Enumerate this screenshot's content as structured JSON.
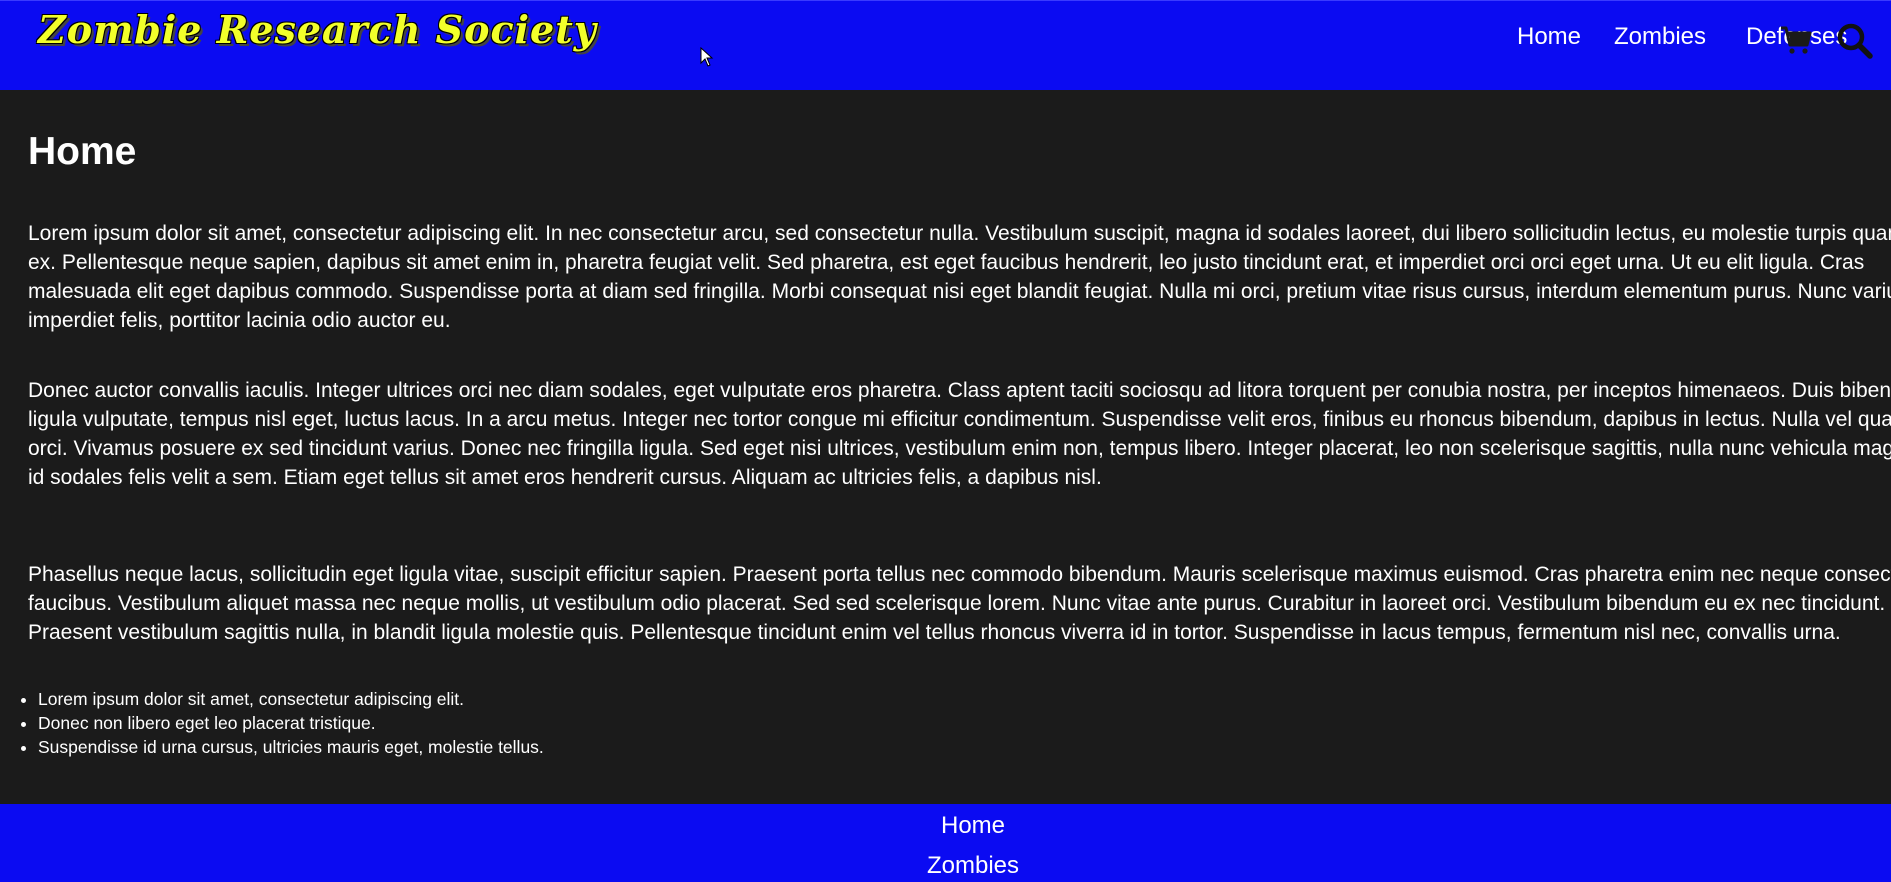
{
  "header": {
    "logo_text": "Zombie Research Society",
    "nav": [
      {
        "label": "Home"
      },
      {
        "label": "Zombies"
      },
      {
        "label": "Defenses"
      }
    ],
    "icons": {
      "cart": "cart-icon",
      "search": "search-icon"
    }
  },
  "main": {
    "title": "Home",
    "paragraphs": [
      "Lorem ipsum dolor sit amet, consectetur adipiscing elit. In nec consectetur arcu, sed consectetur nulla. Vestibulum suscipit, magna id sodales laoreet, dui libero sollicitudin lectus, eu molestie turpis quam id ex. Pellentesque neque sapien, dapibus sit amet enim in, pharetra feugiat velit. Sed pharetra, est eget faucibus hendrerit, leo justo tincidunt erat, et imperdiet orci orci eget urna. Ut eu elit ligula. Cras malesuada elit eget dapibus commodo. Suspendisse porta at diam sed fringilla. Morbi consequat nisi eget blandit feugiat. Nulla mi orci, pretium vitae risus cursus, interdum elementum purus. Nunc varius imperdiet felis, porttitor lacinia odio auctor eu.",
      "Donec auctor convallis iaculis. Integer ultrices orci nec diam sodales, eget vulputate eros pharetra. Class aptent taciti sociosqu ad litora torquent per conubia nostra, per inceptos himenaeos. Duis bibendum ligula vulputate, tempus nisl eget, luctus lacus. In a arcu metus. Integer nec tortor congue mi efficitur condimentum. Suspendisse velit eros, finibus eu rhoncus bibendum, dapibus in lectus. Nulla vel quam orci. Vivamus posuere ex sed tincidunt varius. Donec nec fringilla ligula. Sed eget nisi ultrices, vestibulum enim non, tempus libero. Integer placerat, leo non scelerisque sagittis, nulla nunc vehicula magna, id sodales felis velit a sem. Etiam eget tellus sit amet eros hendrerit cursus. Aliquam ac ultricies felis, a dapibus nisl.",
      "Phasellus neque lacus, sollicitudin eget ligula vitae, suscipit efficitur sapien. Praesent porta tellus nec commodo bibendum. Mauris scelerisque maximus euismod. Cras pharetra enim nec neque consectetur faucibus. Vestibulum aliquet massa nec neque mollis, ut vestibulum odio placerat. Sed sed scelerisque lorem. Nunc vitae ante purus. Curabitur in laoreet orci. Vestibulum bibendum eu ex nec tincidunt. Praesent vestibulum sagittis nulla, in blandit ligula molestie quis. Pellentesque tincidunt enim vel tellus rhoncus viverra id in tortor. Suspendisse in lacus tempus, fermentum nisl nec, convallis urna."
    ],
    "list": [
      "Lorem ipsum dolor sit amet, consectetur adipiscing elit.",
      "Donec non libero eget leo placerat tristique.",
      "Suspendisse id urna cursus, ultricies mauris eget, molestie tellus."
    ]
  },
  "footer": {
    "links": [
      {
        "label": "Home"
      },
      {
        "label": "Zombies"
      }
    ]
  },
  "colors": {
    "header_bg": "#0b0bf2",
    "page_bg": "#1b1b1b",
    "logo_yellow": "#f2ff2a",
    "text": "#ffffff"
  }
}
